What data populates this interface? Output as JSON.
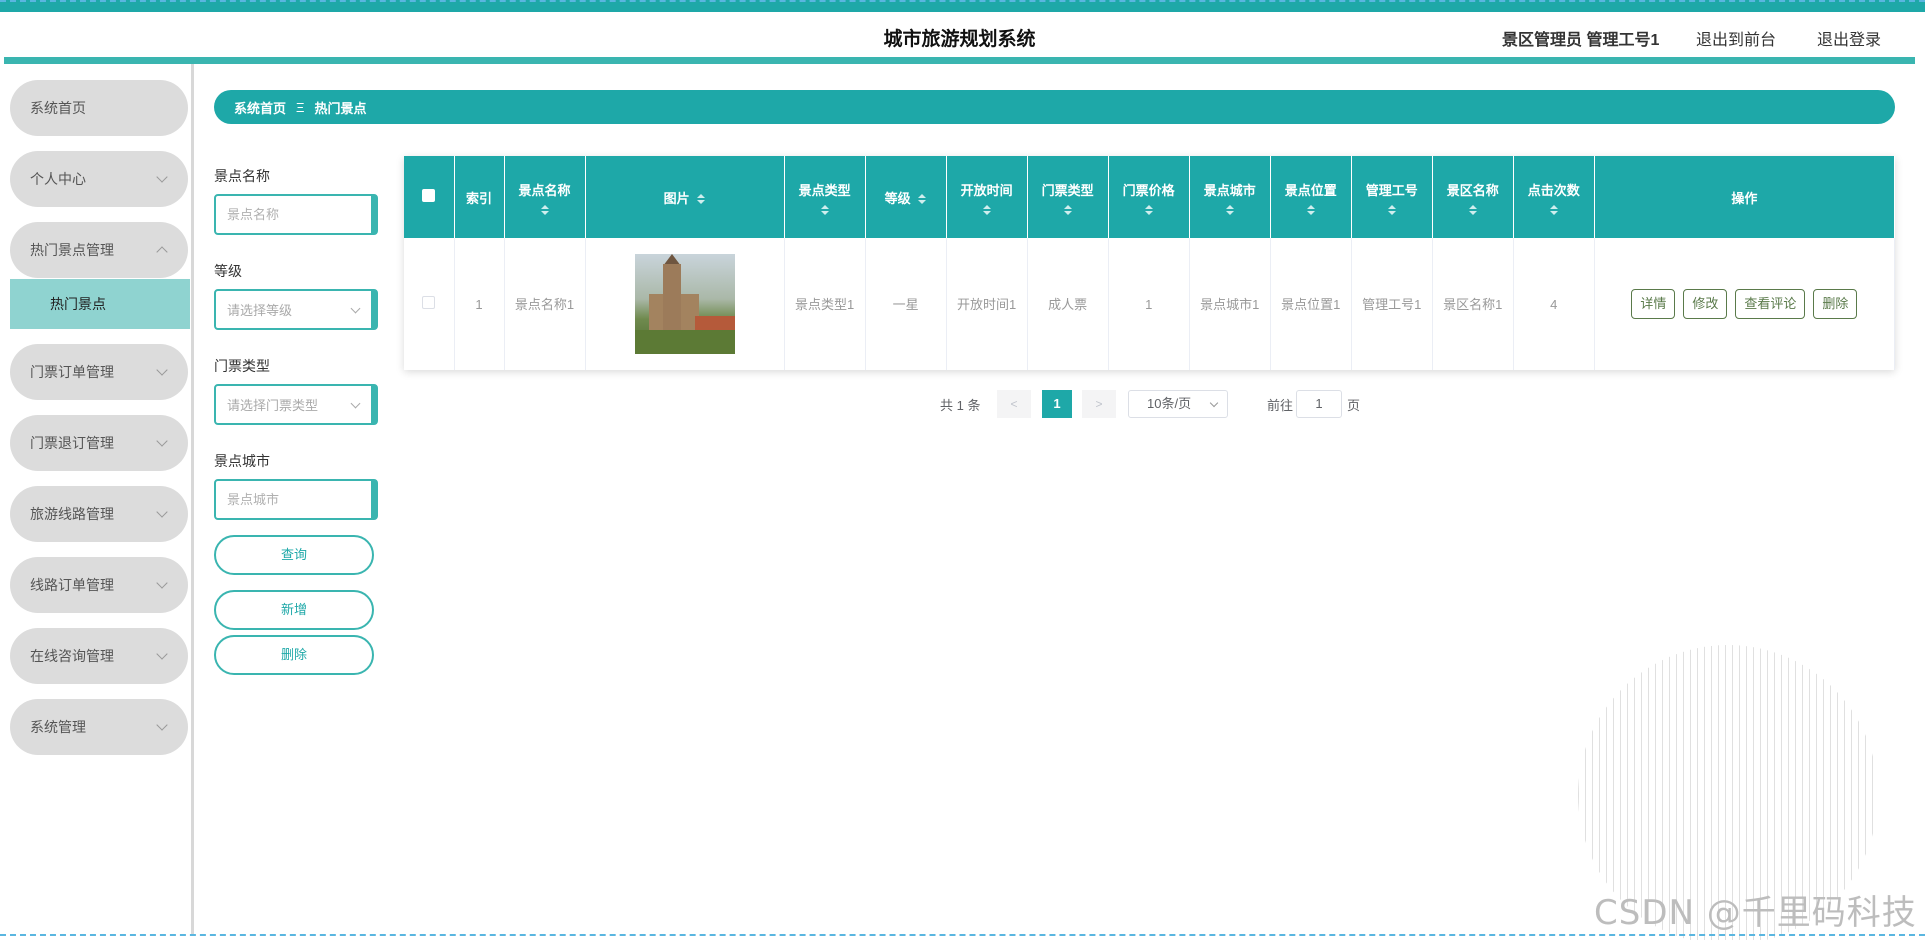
{
  "header": {
    "title": "城市旅游规划系统",
    "user": "景区管理员 管理工号1",
    "link_front": "退出到前台",
    "link_logout": "退出登录"
  },
  "sidebar": {
    "items": [
      {
        "label": "系统首页",
        "has_chevron": false
      },
      {
        "label": "个人中心",
        "has_chevron": true
      },
      {
        "label": "热门景点管理",
        "has_chevron": true,
        "expanded": true
      },
      {
        "label": "门票订单管理",
        "has_chevron": true
      },
      {
        "label": "门票退订管理",
        "has_chevron": true
      },
      {
        "label": "旅游线路管理",
        "has_chevron": true
      },
      {
        "label": "线路订单管理",
        "has_chevron": true
      },
      {
        "label": "在线咨询管理",
        "has_chevron": true
      },
      {
        "label": "系统管理",
        "has_chevron": true
      }
    ],
    "active_sub": "热门景点"
  },
  "breadcrumb": {
    "home": "系统首页",
    "sep": "Ξ",
    "current": "热门景点"
  },
  "search": {
    "name_label": "景点名称",
    "name_placeholder": "景点名称",
    "level_label": "等级",
    "level_placeholder": "请选择等级",
    "ticket_type_label": "门票类型",
    "ticket_type_placeholder": "请选择门票类型",
    "city_label": "景点城市",
    "city_placeholder": "景点城市",
    "query_btn": "查询",
    "add_btn": "新增",
    "delete_btn": "删除"
  },
  "table": {
    "columns": [
      "索引",
      "景点名称",
      "图片",
      "景点类型",
      "等级",
      "开放时间",
      "门票类型",
      "门票价格",
      "景点城市",
      "景点位置",
      "管理工号",
      "景区名称",
      "点击次数",
      "操作"
    ],
    "rows": [
      {
        "index": "1",
        "name": "景点名称1",
        "image": "church-tower-photo",
        "type": "景点类型1",
        "level": "一星",
        "open_time": "开放时间1",
        "ticket_type": "成人票",
        "price": "1",
        "city": "景点城市1",
        "location": "景点位置1",
        "manager_no": "管理工号1",
        "scenic_name": "景区名称1",
        "clicks": "4"
      }
    ],
    "actions": [
      "详情",
      "修改",
      "查看评论",
      "删除"
    ]
  },
  "pagination": {
    "total": "共 1 条",
    "prev": "<",
    "page": "1",
    "next": ">",
    "page_size": "10条/页",
    "goto_prefix": "前往",
    "goto_value": "1",
    "goto_suffix": "页"
  },
  "watermark": "CSDN @千里码科技",
  "colors": {
    "accent": "#1ea8a8",
    "accent_light": "#8fd3d0",
    "menu_bg": "#dcdcdc"
  }
}
